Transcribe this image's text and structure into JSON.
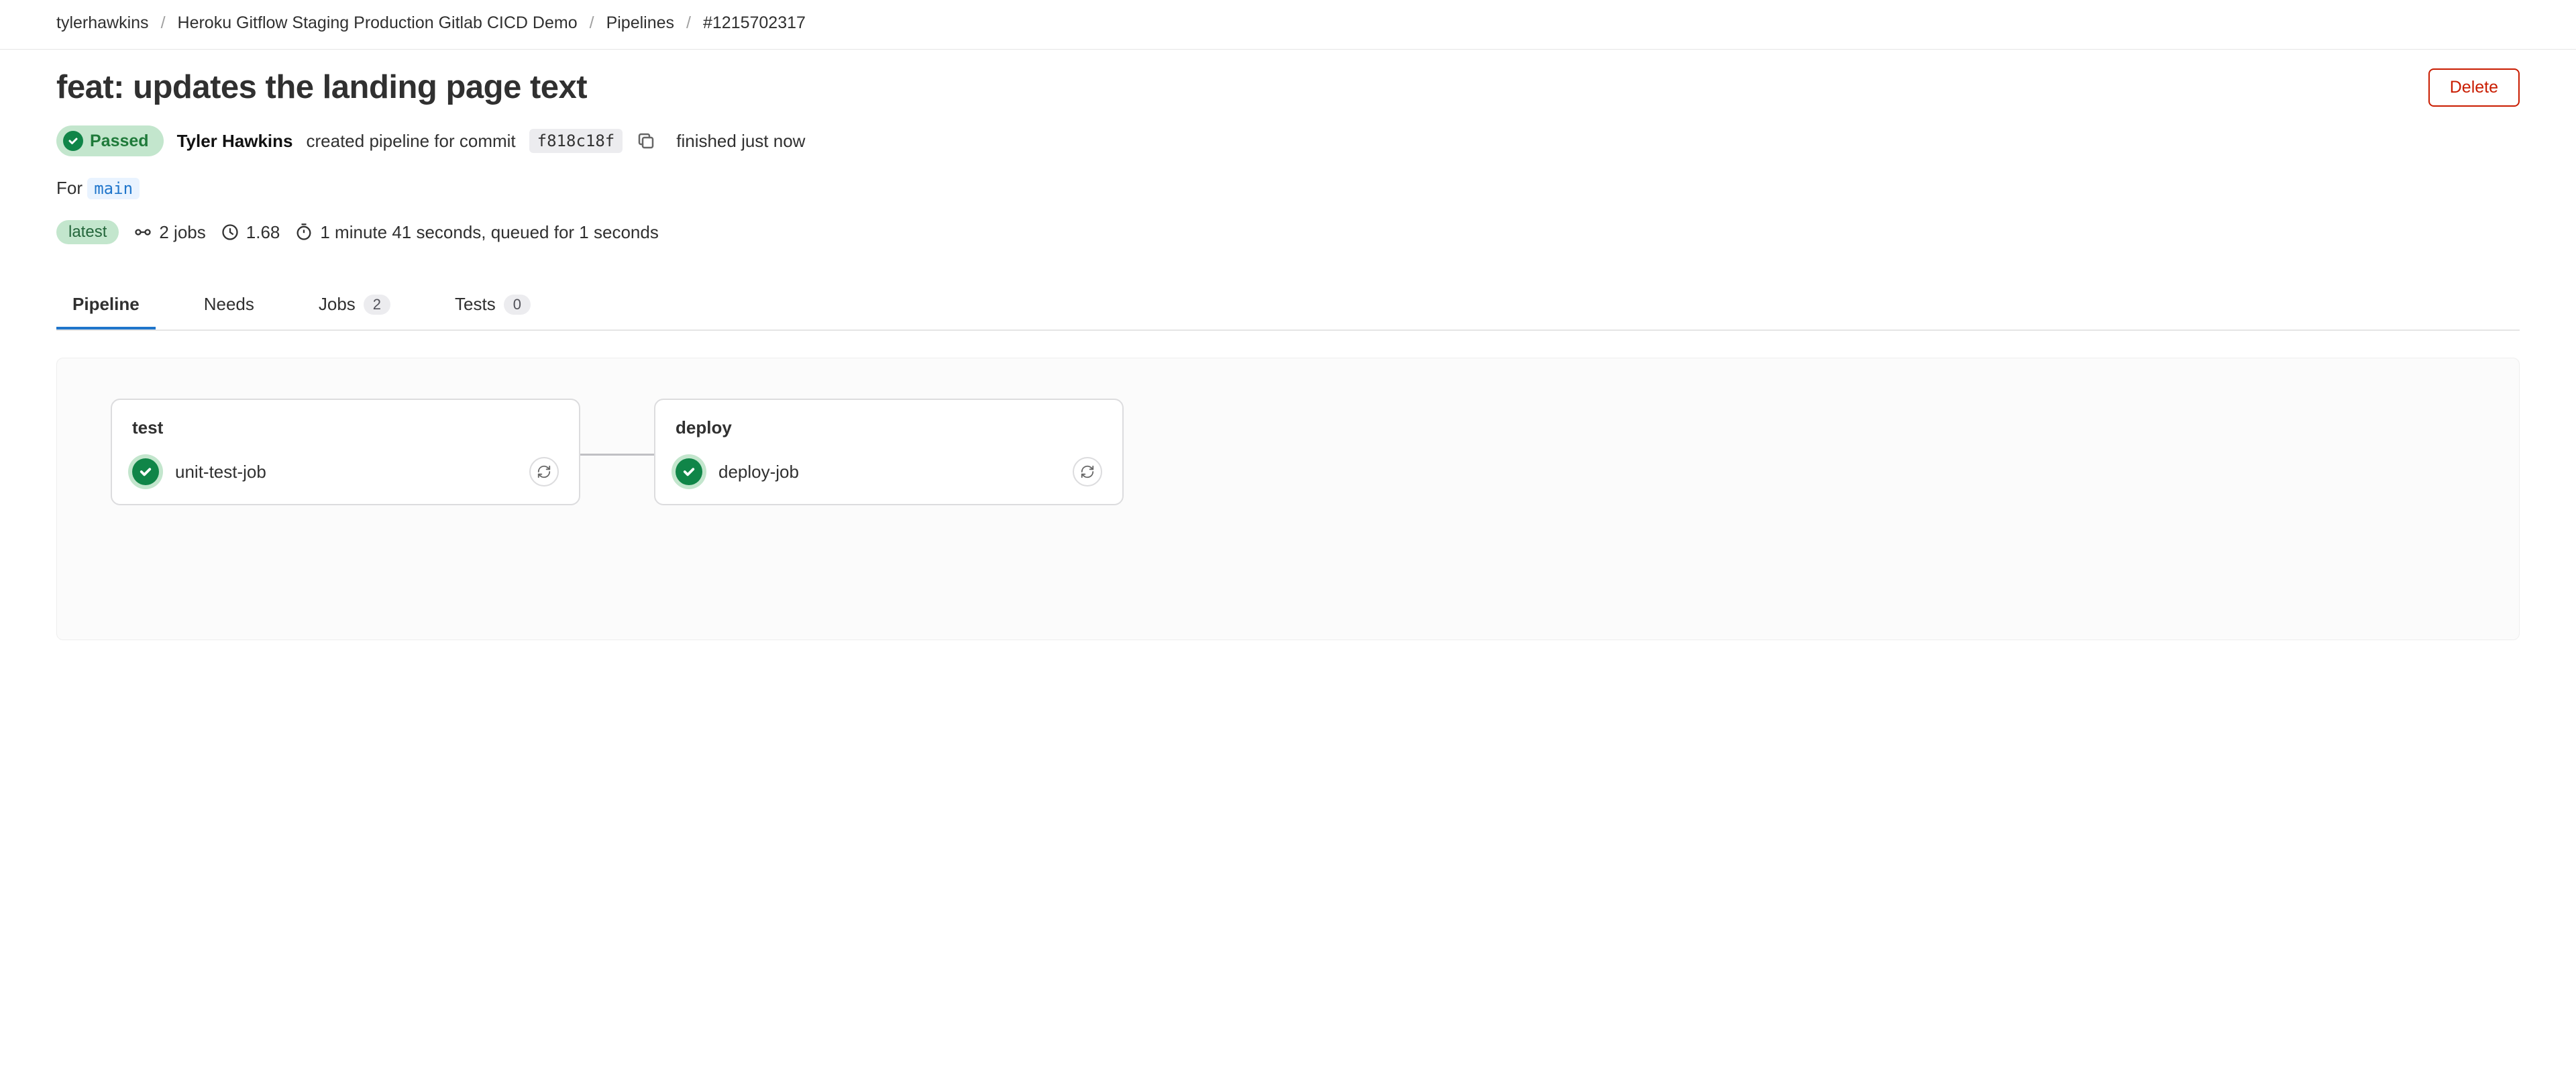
{
  "breadcrumb": {
    "items": [
      {
        "label": "tylerhawkins"
      },
      {
        "label": "Heroku Gitflow Staging Production Gitlab CICD Demo"
      },
      {
        "label": "Pipelines"
      },
      {
        "label": "#1215702317"
      }
    ]
  },
  "header": {
    "title": "feat: updates the landing page text",
    "delete_label": "Delete"
  },
  "meta": {
    "status": "Passed",
    "author": "Tyler Hawkins",
    "created_text": "created pipeline for commit",
    "commit_sha": "f818c18f",
    "finished_text": "finished just now"
  },
  "branch": {
    "for_label": "For",
    "branch_name": "main"
  },
  "stats": {
    "latest_label": "latest",
    "jobs_text": "2 jobs",
    "cost": "1.68",
    "duration": "1 minute 41 seconds, queued for 1 seconds"
  },
  "tabs": {
    "pipeline": "Pipeline",
    "needs": "Needs",
    "jobs": "Jobs",
    "jobs_count": "2",
    "tests": "Tests",
    "tests_count": "0"
  },
  "stages": [
    {
      "name": "test",
      "jobs": [
        {
          "name": "unit-test-job",
          "status": "passed"
        }
      ]
    },
    {
      "name": "deploy",
      "jobs": [
        {
          "name": "deploy-job",
          "status": "passed"
        }
      ]
    }
  ]
}
